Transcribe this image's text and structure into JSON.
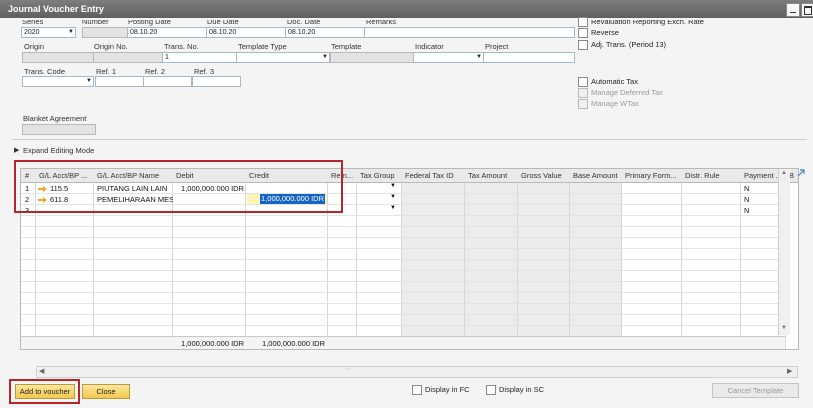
{
  "window": {
    "title": "Journal Voucher Entry"
  },
  "header": {
    "series_label": "Series",
    "number_label": "Number",
    "posting_label": "Posting Date",
    "due_label": "Due Date",
    "doc_label": "Doc. Date",
    "remarks_label": "Remarks",
    "series_value": "2020",
    "posting_value": "08.10.20",
    "due_value": "08.10.20",
    "doc_value": "08.10.20",
    "origin_label": "Origin",
    "origin_no_label": "Origin No.",
    "trans_no_label": "Trans. No.",
    "template_type_label": "Template Type",
    "template_label": "Template",
    "indicator_label": "Indicator",
    "project_label": "Project",
    "trans_no_value": "1",
    "trans_code_label": "Trans. Code",
    "ref1_label": "Ref. 1",
    "ref2_label": "Ref. 2",
    "ref3_label": "Ref. 3",
    "blanket_label": "Blanket Agreement"
  },
  "options": {
    "revaluation": "Revaluation Reporting Exch. Rate",
    "reverse": "Reverse",
    "adj_trans": "Adj. Trans. (Period 13)",
    "automatic_tax": "Automatic Tax",
    "manage_deferred_tax": "Manage Deferred Tax",
    "manage_wtax": "Manage WTax"
  },
  "expand": {
    "label": "Expand Editing Mode"
  },
  "table": {
    "columns": [
      "#",
      "G/L Acct/BP ...",
      "G/L Acct/BP Name",
      "Debit",
      "Credit",
      "Rem...",
      "Tax Group",
      "Federal Tax ID",
      "Tax Amount",
      "Gross Value",
      "Base Amount",
      "Primary Form...",
      "Distr. Rule",
      "Payment ...",
      "B"
    ],
    "rows": [
      {
        "num": "1",
        "acct": "115.5",
        "name": "PIUTANG LAIN LAIN",
        "debit": "1,000,000.000 IDR",
        "credit": "",
        "payment": "N"
      },
      {
        "num": "2",
        "acct": "611.8",
        "name": "PEMELIHARAAN MESI",
        "debit": "",
        "credit": "1,000,000.000 IDR",
        "payment": "N"
      },
      {
        "num": "3",
        "acct": "",
        "name": "",
        "debit": "",
        "credit": "",
        "payment": "N"
      }
    ],
    "total_debit": "1,000,000.000 IDR",
    "total_credit": "1,000,000.000 IDR"
  },
  "footer": {
    "add_label": "Add to voucher",
    "close_label": "Close",
    "display_fc": "Display in FC",
    "display_sc": "Display in SC",
    "cancel_template": "Cancel Template"
  },
  "colors": {
    "button_accent": "#f3c94c",
    "highlight_box": "#b3262b",
    "selected_cell": "#1565c0"
  }
}
